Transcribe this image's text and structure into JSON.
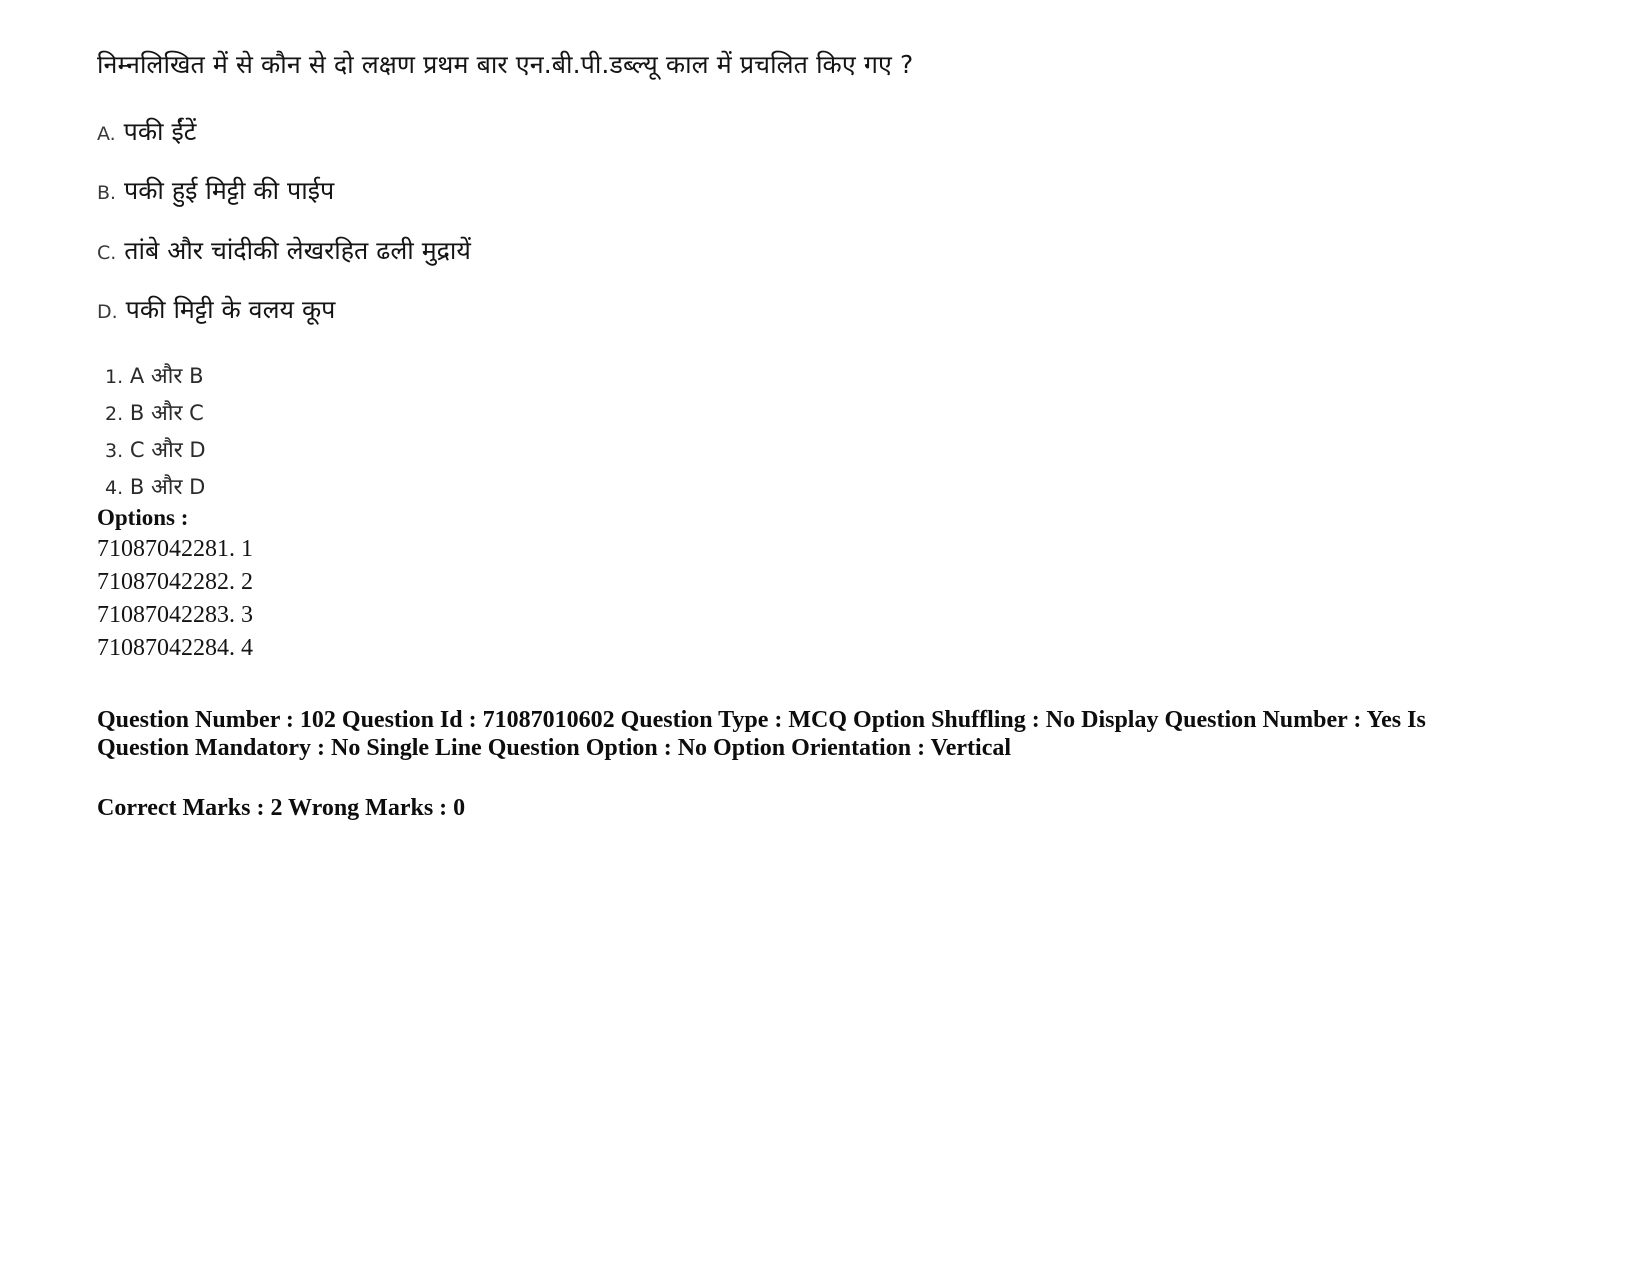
{
  "question": {
    "stem": "निम्नलिखित में से कौन से दो लक्षण प्रथम बार एन.बी.पी.डब्ल्यू काल में प्रचलित किए गए ?",
    "statements": [
      {
        "letter": "A.",
        "text": "पकी ईंटें"
      },
      {
        "letter": "B.",
        "text": "पकी हुई मिट्टी की पाईप"
      },
      {
        "letter": "C.",
        "text": "तांबे और चांदीकी लेखरहित ढली मुद्रायें"
      },
      {
        "letter": "D.",
        "text": "पकी मिट्टी के वलय कूप"
      }
    ],
    "choices": [
      {
        "number": "1.",
        "left": "A",
        "conj": "और",
        "right": "B"
      },
      {
        "number": "2.",
        "left": "B",
        "conj": "और",
        "right": "C"
      },
      {
        "number": "3.",
        "left": "C",
        "conj": "और",
        "right": "D"
      },
      {
        "number": "4.",
        "left": "B",
        "conj": "और",
        "right": "D"
      }
    ]
  },
  "options": {
    "heading": "Options :",
    "rows": [
      "71087042281. 1",
      "71087042282. 2",
      "71087042283. 3",
      "71087042284. 4"
    ]
  },
  "metadata": {
    "line1": "Question Number : 102 Question Id : 71087010602 Question Type : MCQ Option Shuffling : No Display Question Number : Yes Is Question Mandatory : No Single Line Question Option : No Option Orientation : Vertical",
    "line2": "Correct Marks : 2 Wrong Marks : 0"
  }
}
